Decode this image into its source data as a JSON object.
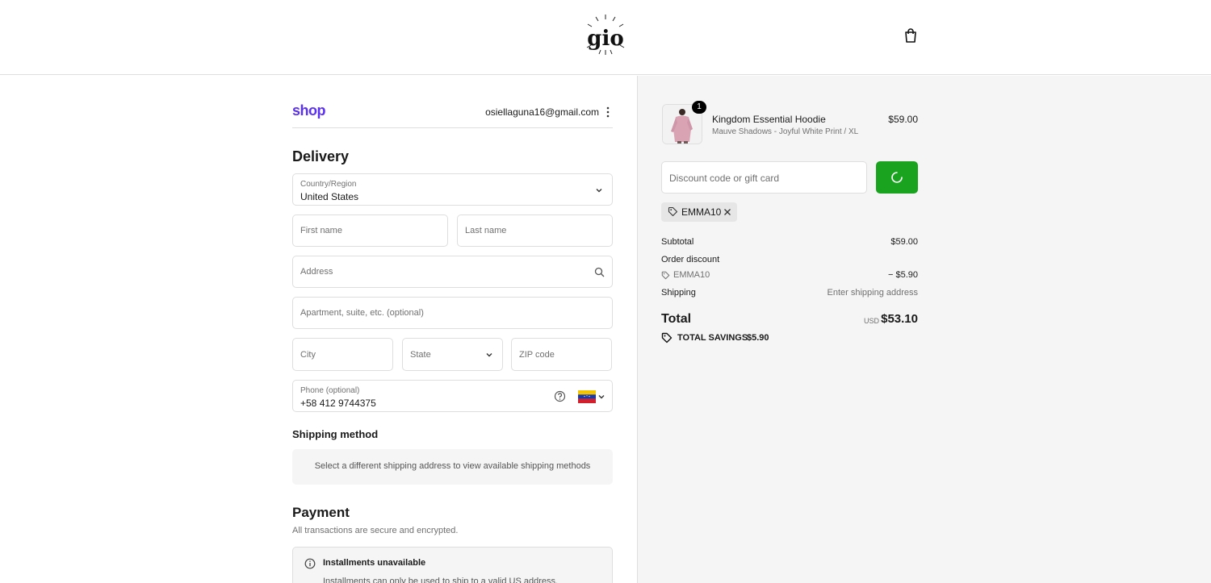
{
  "header": {
    "logo_text": "gio",
    "cart_icon": "shopping-bag-icon"
  },
  "account": {
    "shop_logo": "shop",
    "email": "osiellaguna16@gmail.com",
    "menu_icon": "kebab-icon"
  },
  "delivery": {
    "title": "Delivery",
    "country": {
      "label": "Country/Region",
      "value": "United States"
    },
    "first_name": {
      "placeholder": "First name"
    },
    "last_name": {
      "placeholder": "Last name"
    },
    "address": {
      "placeholder": "Address",
      "icon": "search-icon"
    },
    "apartment": {
      "placeholder": "Apartment, suite, etc. (optional)"
    },
    "city": {
      "placeholder": "City"
    },
    "state": {
      "placeholder": "State"
    },
    "zip": {
      "placeholder": "ZIP code"
    },
    "phone": {
      "label": "Phone (optional)",
      "value": "+58 412 9744375",
      "flag": "venezuela-flag-icon"
    }
  },
  "shipping_method": {
    "title": "Shipping method",
    "message": "Select a different shipping address to view available shipping methods"
  },
  "payment": {
    "title": "Payment",
    "subtitle": "All transactions are secure and encrypted.",
    "installments_title": "Installments unavailable",
    "installments_text": "Installments can only be used to ship to a valid US address."
  },
  "order": {
    "item": {
      "quantity": "1",
      "name": "Kingdom Essential Hoodie",
      "variant": "Mauve Shadows - Joyful White Print / XL",
      "price": "$59.00"
    },
    "discount_placeholder": "Discount code or gift card",
    "applied_code": "EMMA10",
    "subtotal_label": "Subtotal",
    "subtotal_value": "$59.00",
    "order_discount_label": "Order discount",
    "discount_code": "EMMA10",
    "discount_value": "− $5.90",
    "shipping_label": "Shipping",
    "shipping_value": "Enter shipping address",
    "total_label": "Total",
    "currency": "USD",
    "total_value": "$53.10",
    "savings_label": "TOTAL SAVINGS",
    "savings_value": "$5.90"
  },
  "colors": {
    "accent_green": "#1aa31f",
    "shop_purple": "#5a31f4"
  }
}
